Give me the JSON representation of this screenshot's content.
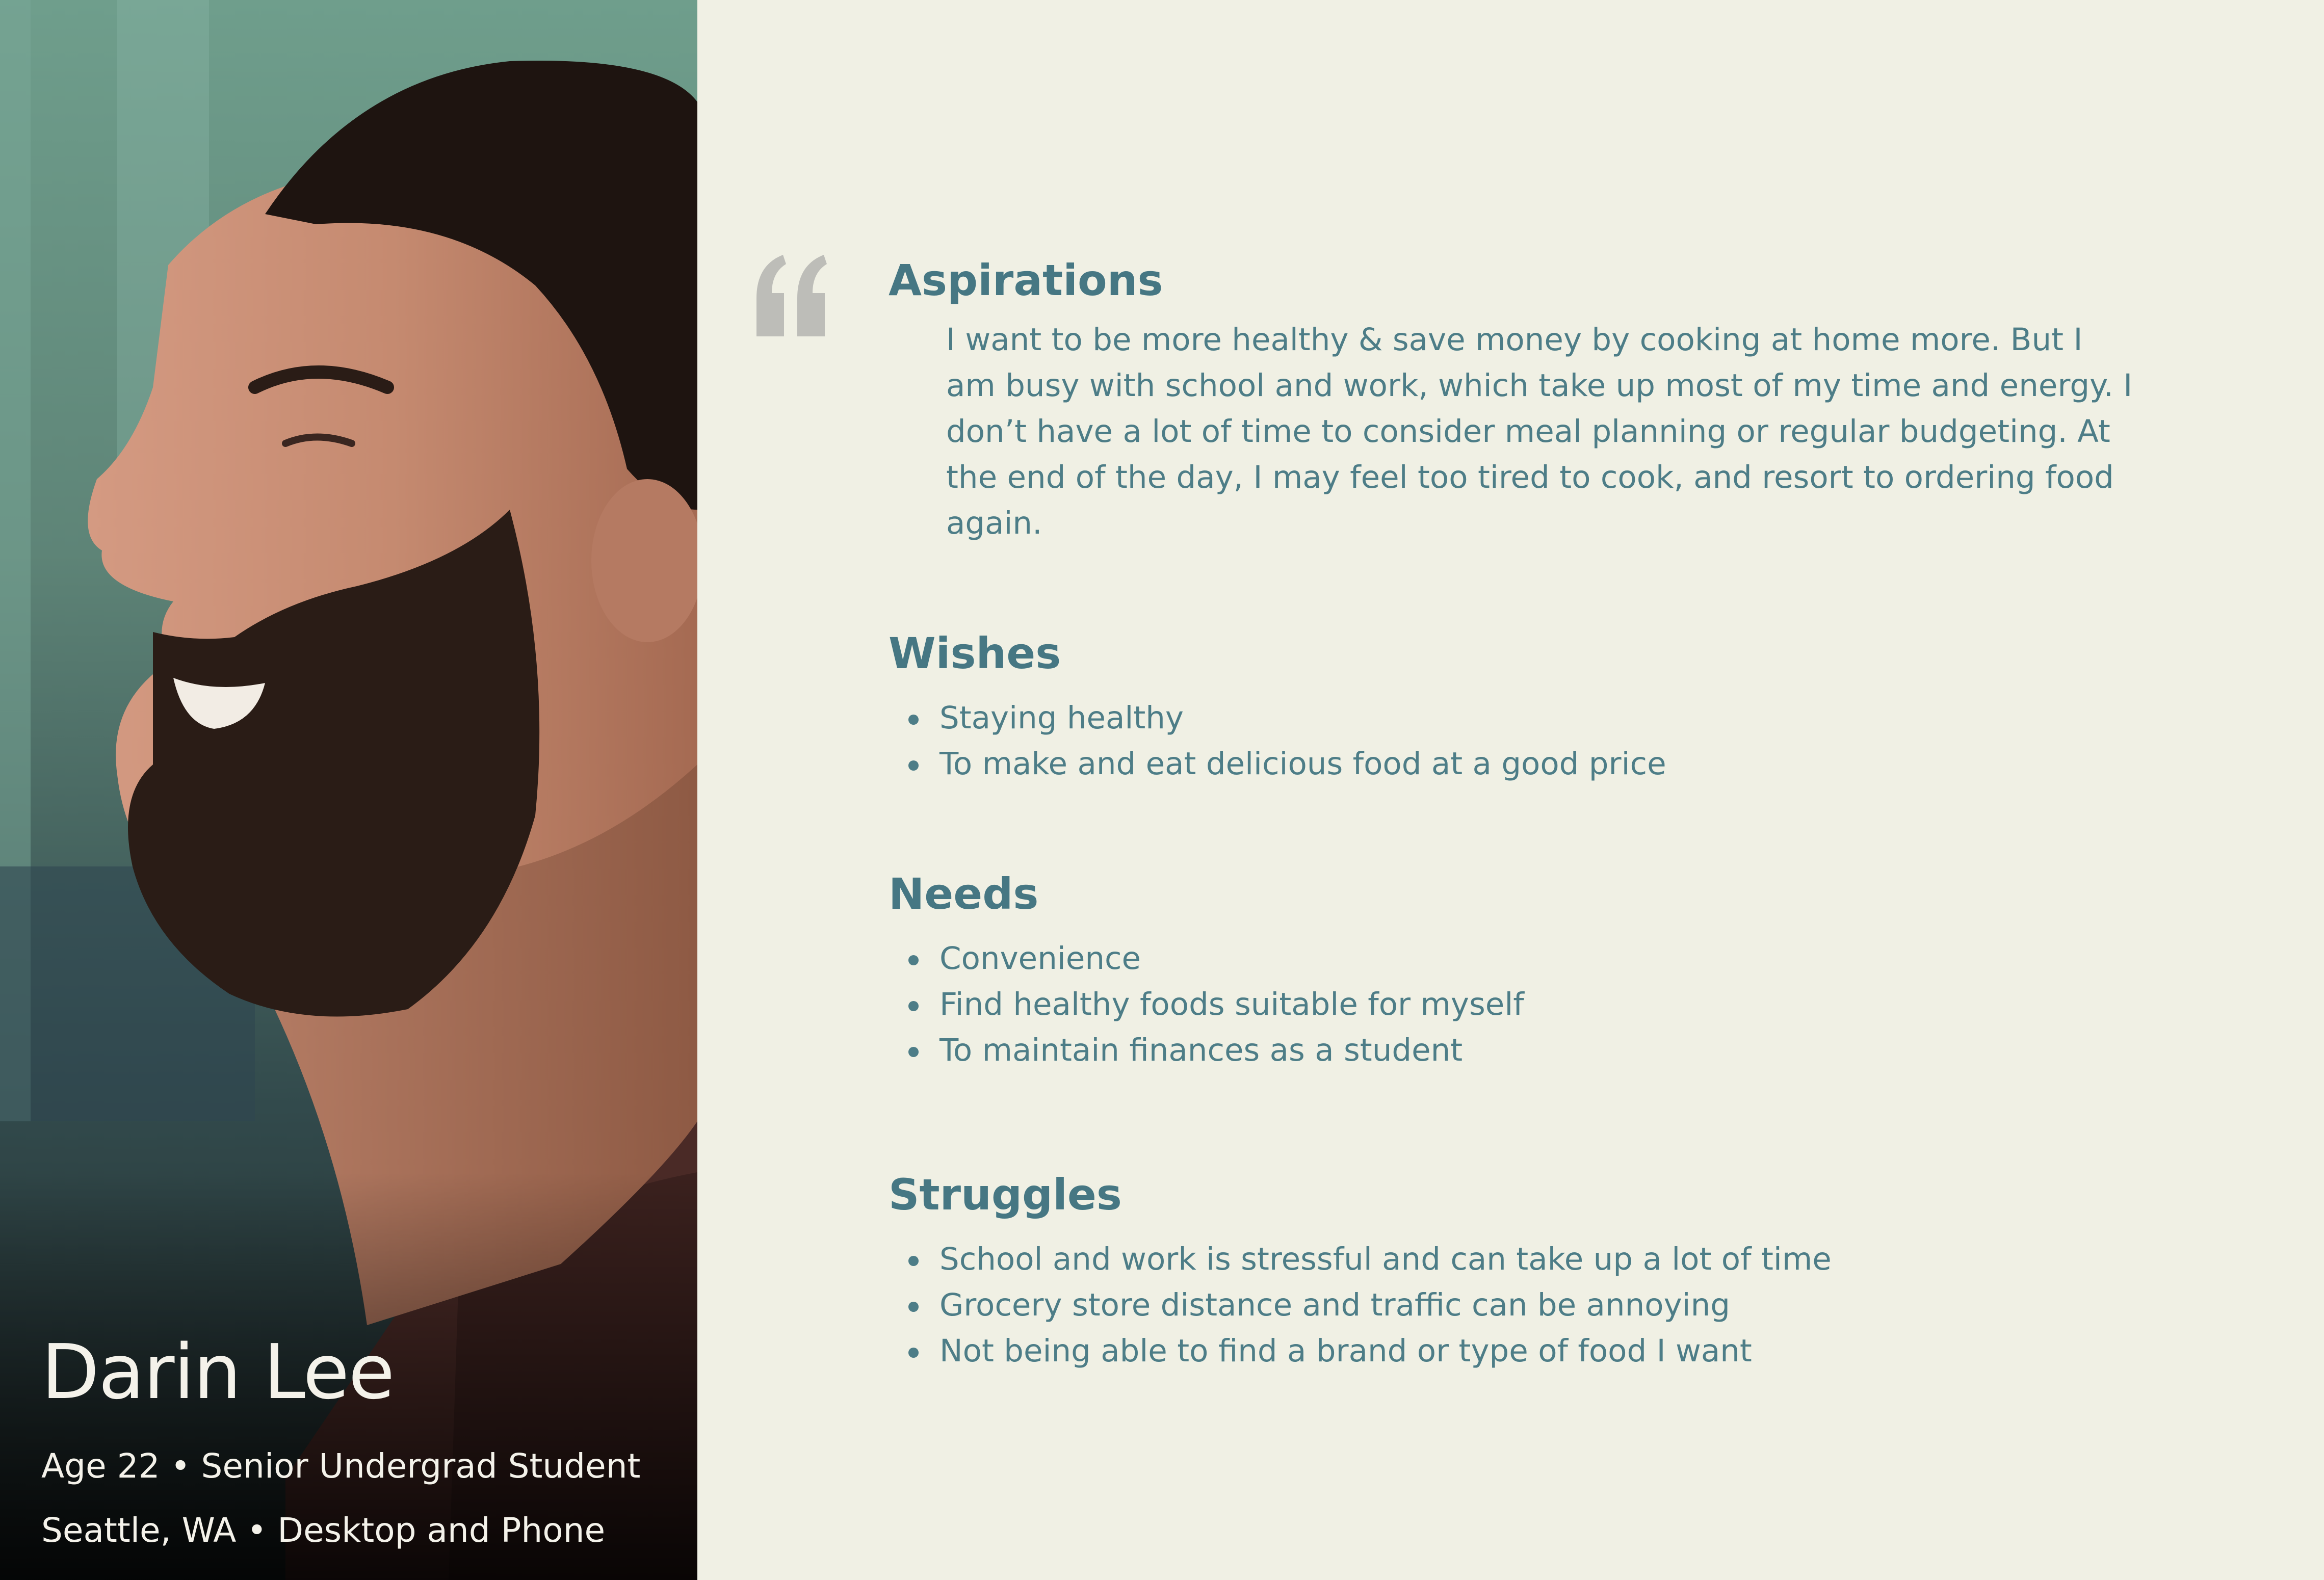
{
  "persona": {
    "name": "Darin Lee",
    "line1": "Age 22 • Senior Undergrad Student",
    "line2": "Seattle, WA • Desktop and Phone"
  },
  "sections": {
    "aspirations": {
      "title": "Aspirations",
      "text": "I want to be more healthy & save money by cooking at home more. But I am busy with school and work, which take up most of my time and energy. I don’t have a lot of time to consider meal planning or regular budgeting. At the end of the day, I may feel too tired to cook, and resort to ordering food again."
    },
    "wishes": {
      "title": "Wishes",
      "items": [
        "Staying healthy",
        "To make and eat delicious food at a good price"
      ]
    },
    "needs": {
      "title": "Needs",
      "items": [
        "Convenience",
        "Find healthy foods suitable for myself",
        "To maintain finances as a student"
      ]
    },
    "struggles": {
      "title": "Struggles",
      "items": [
        "School and work is stressful and can take up a lot of time",
        "Grocery store distance and traffic can be annoying",
        "Not being able to find a brand or type of food I want"
      ]
    }
  },
  "colors": {
    "background": "#f0f0e4",
    "heading": "#467783",
    "body_text": "#4d7d87",
    "quote_mark": "#bdbdb8",
    "name_text": "#f4f2ea"
  },
  "icons": {
    "quote": "open-quote-icon"
  }
}
